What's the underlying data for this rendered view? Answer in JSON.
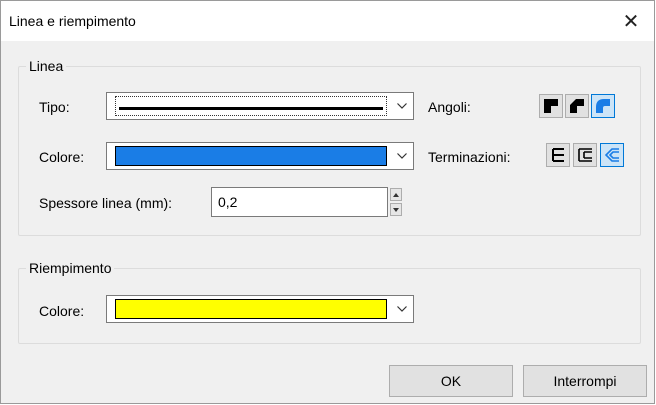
{
  "window": {
    "title": "Linea e riempimento",
    "close_glyph": "✕"
  },
  "line_group": {
    "label": "Linea",
    "type_label": "Tipo:",
    "color_label": "Colore:",
    "color_value": "#1a7de6",
    "width_label": "Spessore linea (mm):",
    "width_value": "0,2",
    "corners_label": "Angoli:",
    "corners": [
      {
        "name": "square-corner-icon",
        "selected": false
      },
      {
        "name": "bevel-corner-icon",
        "selected": false
      },
      {
        "name": "round-corner-icon",
        "selected": true
      }
    ],
    "ends_label": "Terminazioni:",
    "ends": [
      {
        "name": "flat-end-icon",
        "selected": false
      },
      {
        "name": "square-end-icon",
        "selected": false
      },
      {
        "name": "round-end-icon",
        "selected": true
      }
    ]
  },
  "fill_group": {
    "label": "Riempimento",
    "color_label": "Colore:",
    "color_value": "#ffff00"
  },
  "buttons": {
    "ok": "OK",
    "cancel": "Interrompi"
  },
  "colors": {
    "accent": "#0078d7",
    "line_blue": "#1a7de6",
    "fill_yellow": "#ffff00"
  }
}
